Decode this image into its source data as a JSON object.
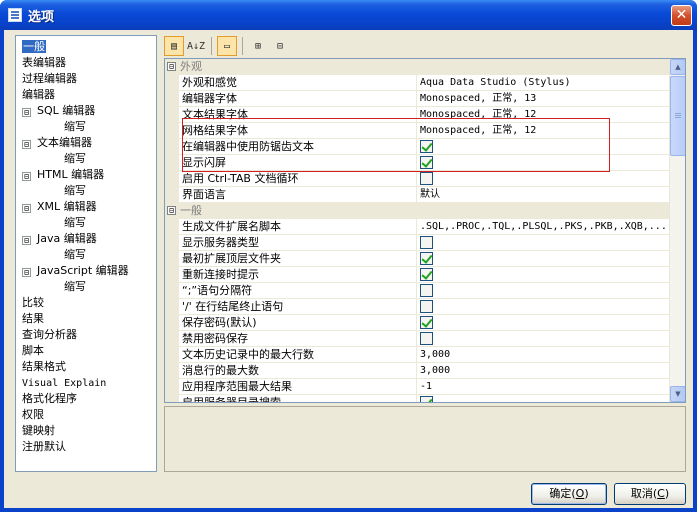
{
  "window": {
    "title": "选项",
    "close_glyph": "✕"
  },
  "tree": [
    {
      "label": "一般",
      "level": 1,
      "selected": true
    },
    {
      "label": "表编辑器",
      "level": 1
    },
    {
      "label": "过程编辑器",
      "level": 1
    },
    {
      "label": "编辑器",
      "level": 1
    },
    {
      "label": "SQL 编辑器",
      "level": 1,
      "expander": "⊟"
    },
    {
      "label": "缩写",
      "level": 2
    },
    {
      "label": "文本编辑器",
      "level": 1,
      "expander": "⊟"
    },
    {
      "label": "缩写",
      "level": 2
    },
    {
      "label": "HTML 编辑器",
      "level": 1,
      "expander": "⊟"
    },
    {
      "label": "缩写",
      "level": 2
    },
    {
      "label": "XML 编辑器",
      "level": 1,
      "expander": "⊟"
    },
    {
      "label": "缩写",
      "level": 2
    },
    {
      "label": "Java 编辑器",
      "level": 1,
      "expander": "⊟"
    },
    {
      "label": "缩写",
      "level": 2
    },
    {
      "label": "JavaScript 编辑器",
      "level": 1,
      "expander": "⊟"
    },
    {
      "label": "缩写",
      "level": 2
    },
    {
      "label": "比较",
      "level": 1
    },
    {
      "label": "结果",
      "level": 1
    },
    {
      "label": "查询分析器",
      "level": 1
    },
    {
      "label": "脚本",
      "level": 1
    },
    {
      "label": "结果格式",
      "level": 1
    },
    {
      "label": "Visual Explain",
      "level": 1,
      "mono": true
    },
    {
      "label": "格式化程序",
      "level": 1
    },
    {
      "label": "权限",
      "level": 1
    },
    {
      "label": "键映射",
      "level": 1
    },
    {
      "label": "注册默认",
      "level": 1
    }
  ],
  "toolbar": {
    "categorized_label": "▤",
    "alphabetic_label": "A↓Z",
    "pages_label": "▭",
    "expand_label": "⊞",
    "collapse_label": "⊟"
  },
  "grid": {
    "rows": [
      {
        "type": "cat",
        "label": "外观",
        "expander": "⊟"
      },
      {
        "name": "外观和感觉",
        "value": "Aqua Data Studio (Stylus)"
      },
      {
        "name": "编辑器字体",
        "value": "Monospaced, 正常, 13"
      },
      {
        "name": "文本结果字体",
        "value": "Monospaced, 正常, 12"
      },
      {
        "name": "网格结果字体",
        "value": "Monospaced, 正常, 12"
      },
      {
        "name": "在编辑器中使用防锯齿文本",
        "check": true
      },
      {
        "name": "显示闪屏",
        "check": true
      },
      {
        "name": "启用 Ctrl-TAB 文档循环",
        "check": false
      },
      {
        "name": "界面语言",
        "value": "默认"
      },
      {
        "type": "cat",
        "label": "一般",
        "expander": "⊟"
      },
      {
        "name": "生成文件扩展名脚本",
        "value": ".SQL,.PROC,.TQL,.PLSQL,.PKS,.PKB,.XQB,..."
      },
      {
        "name": "显示服务器类型",
        "check": false
      },
      {
        "name": "最初扩展顶层文件夹",
        "check": true
      },
      {
        "name": "重新连接时提示",
        "check": true
      },
      {
        "name": "“;”语句分隔符",
        "check": false
      },
      {
        "name": "'/' 在行结尾终止语句",
        "check": false
      },
      {
        "name": "保存密码(默认)",
        "check": true
      },
      {
        "name": "禁用密码保存",
        "check": false
      },
      {
        "name": "文本历史记录中的最大行数",
        "value": "3,000"
      },
      {
        "name": "消息行的最大数",
        "value": "3,000"
      },
      {
        "name": "应用程序范围最大结果",
        "value": "-1"
      },
      {
        "name": "启用服务器目录搜索",
        "check": true
      }
    ]
  },
  "buttons": {
    "ok_label": "确定",
    "ok_key": "O",
    "cancel_label": "取消",
    "cancel_key": "C"
  },
  "scrollbar": {
    "up_glyph": "▲",
    "down_glyph": "▼"
  },
  "colors": {
    "title_bar": "#0a4ad8",
    "selection": "#316ac5",
    "highlight_box": "#d02020",
    "check": "#21a121"
  }
}
